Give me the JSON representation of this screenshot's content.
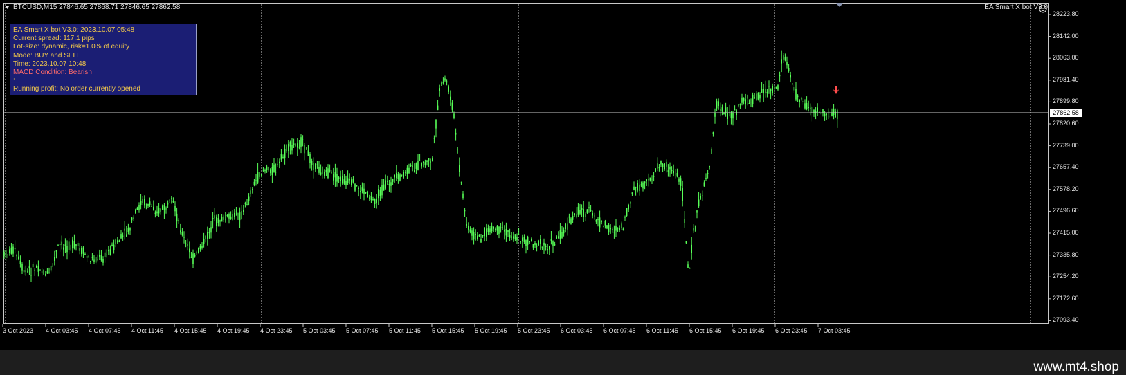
{
  "header": {
    "symbol_line": "BTCUSD,M15  27846.65 27868.71 27846.65 27862.58",
    "ea_title": "EA Smart X bot V3.0"
  },
  "info_panel": {
    "lines": [
      "EA Smart X bot V3.0: 2023.10.07 05:48",
      "Current spread: 117.1 pips",
      "Lot-size: dynamic, risk=1.0% of equity",
      "Mode: BUY and SELL",
      "Time: 2023.10.07 10:48",
      "MACD Condition: Bearish",
      ":",
      "Running profit: No order currently opened"
    ]
  },
  "price_axis": {
    "ticks": [
      "28223.80",
      "28142.00",
      "28063.00",
      "27981.40",
      "27899.80",
      "27820.60",
      "27739.00",
      "27657.40",
      "27578.20",
      "27496.60",
      "27415.00",
      "27335.80",
      "27254.20",
      "27172.60",
      "27093.40"
    ],
    "current_price": "27862.58"
  },
  "time_axis": {
    "ticks": [
      "3 Oct 2023",
      "4 Oct 03:45",
      "4 Oct 07:45",
      "4 Oct 11:45",
      "4 Oct 15:45",
      "4 Oct 19:45",
      "4 Oct 23:45",
      "5 Oct 03:45",
      "5 Oct 07:45",
      "5 Oct 11:45",
      "5 Oct 15:45",
      "5 Oct 19:45",
      "5 Oct 23:45",
      "6 Oct 03:45",
      "6 Oct 07:45",
      "6 Oct 11:45",
      "6 Oct 15:45",
      "6 Oct 19:45",
      "6 Oct 23:45",
      "7 Oct 03:45"
    ]
  },
  "colors": {
    "candle": "#58ff58",
    "price_line": "#c8c8c8",
    "sell_arrow": "#ff4c4c",
    "panel_bg": "#1b1e74"
  },
  "icons": {
    "smiley": "smiley-icon",
    "sell_arrow": "sell-arrow-icon",
    "menu": "menu-triangle-icon"
  },
  "footer": {
    "watermark": "www.mt4.shop"
  }
}
